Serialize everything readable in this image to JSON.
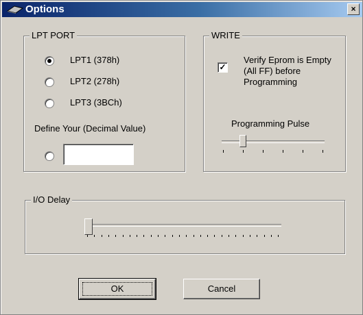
{
  "window": {
    "title": "Options",
    "close_label": "×"
  },
  "lpt_port": {
    "legend": "LPT PORT",
    "options": [
      {
        "label": "LPT1  (378h)",
        "selected": true
      },
      {
        "label": "LPT2  (278h)",
        "selected": false
      },
      {
        "label": "LPT3  (3BCh)",
        "selected": false
      }
    ],
    "define_label": "Define Your (Decimal Value)",
    "custom_selected": false,
    "custom_value": ""
  },
  "write": {
    "legend": "WRITE",
    "verify_label_line1": "Verify Eprom is Empty",
    "verify_label_line2": "(All  FF)  before",
    "verify_label_line3": "Programming",
    "verify_checked": true,
    "check_mark": "✓",
    "pulse_label": "Programming Pulse",
    "pulse_level": 0.2
  },
  "io_delay": {
    "legend": "I/O Delay",
    "level": 0.0
  },
  "buttons": {
    "ok": "OK",
    "cancel": "Cancel"
  }
}
